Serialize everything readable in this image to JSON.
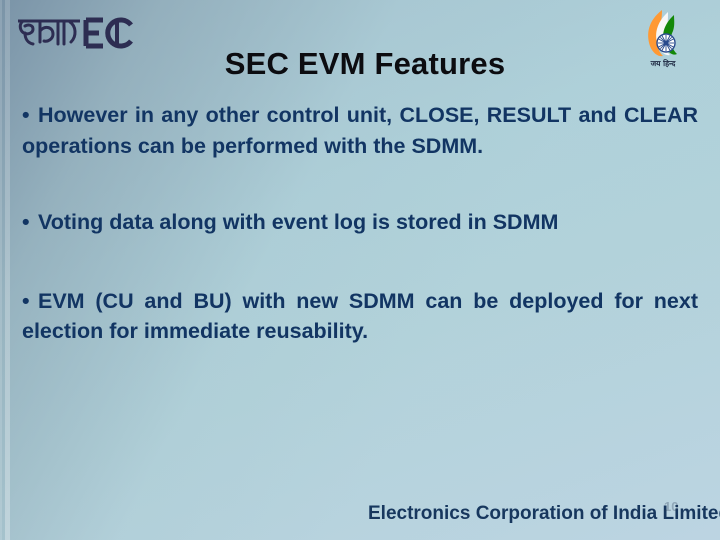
{
  "slide": {
    "title": "SEC EVM Features",
    "background_color_top_left": "#8fa9b4",
    "background_color_bottom_right": "#bcd4e2",
    "title_color": "#0c0c10",
    "body_text_color": "#123563",
    "footer_color": "#17375e"
  },
  "logos": {
    "ecil": {
      "name": "ecil-logo",
      "devanagari_text": "इका",
      "latin_text": "ECIL",
      "color": "#2a2a4e"
    },
    "jai_hind": {
      "name": "jai-hind-emblem",
      "caption": "जय हिन्द",
      "saffron": "#ff9933",
      "white": "#ffffff",
      "green": "#138808",
      "chakra": "#2a4b8d"
    }
  },
  "bullets": [
    {
      "marker": "•",
      "text": "However in any other control unit,  CLOSE, RESULT and CLEAR operations can be performed with the SDMM."
    },
    {
      "marker": "•",
      "text": "Voting data along with event log is stored in SDMM"
    },
    {
      "marker": "•",
      "text": "EVM (CU and BU) with new SDMM can be deployed for next election for immediate reusability."
    }
  ],
  "footer": {
    "text": "Electronics Corporation of India Limited",
    "slide_number": "10"
  }
}
